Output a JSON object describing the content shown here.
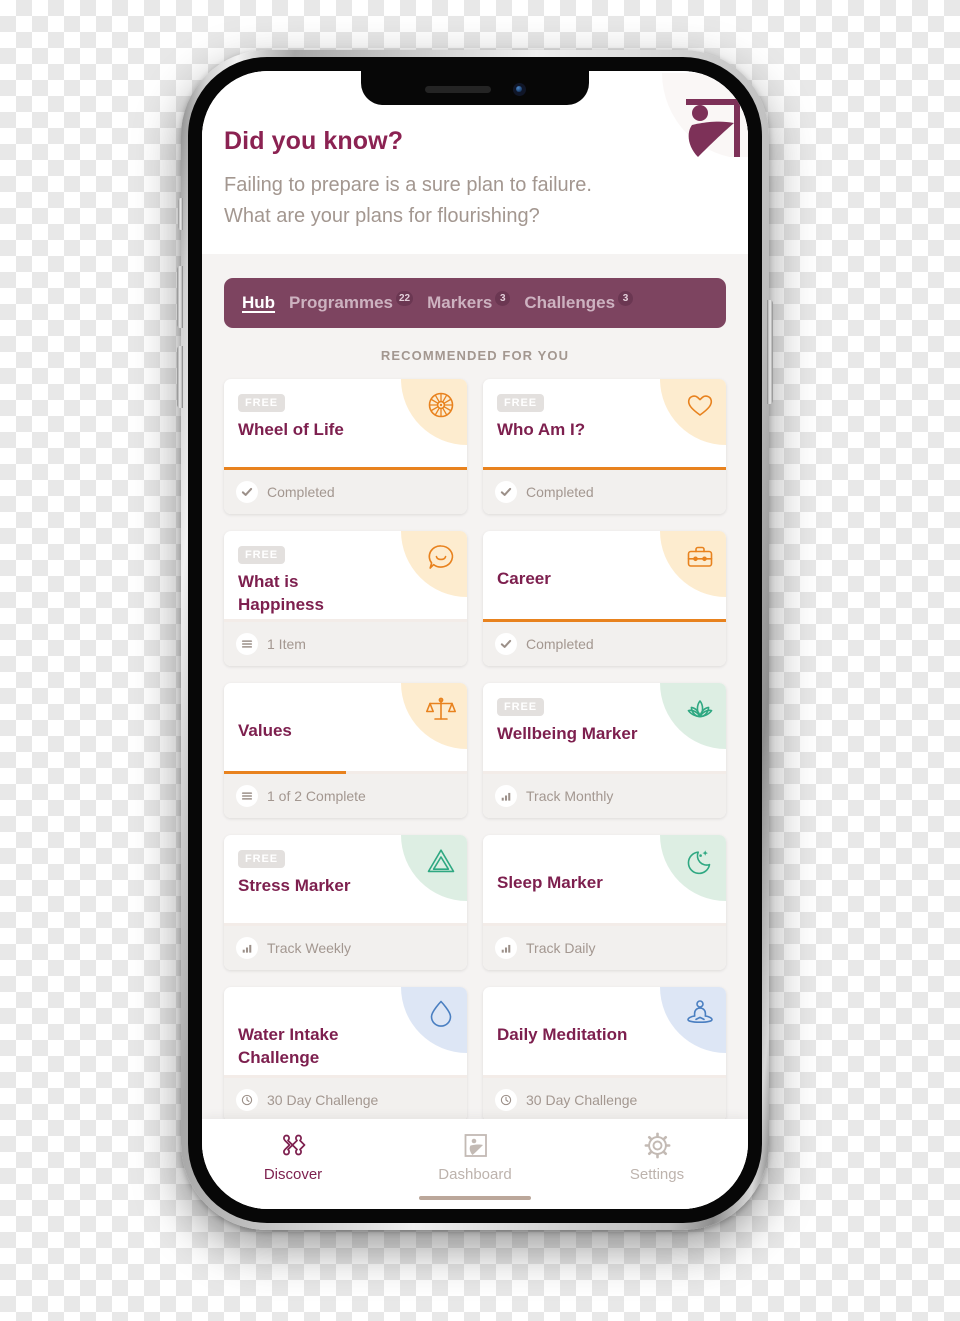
{
  "header": {
    "headline": "Did you know?",
    "subtext_line1": "Failing to prepare is a sure plan to failure.",
    "subtext_line2": "What are your plans for flourishing?",
    "logo_icon": "flourishing-figure-logo"
  },
  "tabs": [
    {
      "label": "Hub",
      "badge": "",
      "active": true
    },
    {
      "label": "Programmes",
      "badge": "22",
      "active": false
    },
    {
      "label": "Markers",
      "badge": "3",
      "active": false
    },
    {
      "label": "Challenges",
      "badge": "3",
      "active": false
    }
  ],
  "section": {
    "title": "RECOMMENDED FOR YOU"
  },
  "cards": [
    {
      "title": "Wheel of Life",
      "free": true,
      "badge_label": "FREE",
      "icon": "wheel-icon",
      "theme": "orange",
      "progress": 100,
      "foot_icon": "check-icon",
      "foot_text": "Completed"
    },
    {
      "title": "Who Am I?",
      "free": true,
      "badge_label": "FREE",
      "icon": "heart-icon",
      "theme": "orange",
      "progress": 100,
      "foot_icon": "check-icon",
      "foot_text": "Completed"
    },
    {
      "title": "What is Happiness",
      "free": true,
      "badge_label": "FREE",
      "icon": "speech-icon",
      "theme": "orange",
      "progress": 0,
      "foot_icon": "list-icon",
      "foot_text": "1 Item"
    },
    {
      "title": "Career",
      "free": false,
      "badge_label": "",
      "icon": "briefcase-icon",
      "theme": "orange",
      "progress": 100,
      "foot_icon": "check-icon",
      "foot_text": "Completed"
    },
    {
      "title": "Values",
      "free": false,
      "badge_label": "",
      "icon": "scales-icon",
      "theme": "orange",
      "progress": 50,
      "foot_icon": "list-icon",
      "foot_text": "1 of 2 Complete"
    },
    {
      "title": "Wellbeing Marker",
      "free": true,
      "badge_label": "FREE",
      "icon": "lotus-icon",
      "theme": "green",
      "progress": 0,
      "foot_icon": "chart-icon",
      "foot_text": "Track Monthly"
    },
    {
      "title": "Stress Marker",
      "free": true,
      "badge_label": "FREE",
      "icon": "triangle-icon",
      "theme": "green",
      "progress": 0,
      "foot_icon": "chart-icon",
      "foot_text": "Track Weekly"
    },
    {
      "title": "Sleep Marker",
      "free": false,
      "badge_label": "",
      "icon": "moon-icon",
      "theme": "green",
      "progress": 0,
      "foot_icon": "chart-icon",
      "foot_text": "Track Daily"
    },
    {
      "title": "Water Intake Challenge",
      "free": false,
      "badge_label": "",
      "icon": "droplet-icon",
      "theme": "blue",
      "progress": 0,
      "foot_icon": "clock-icon",
      "foot_text": "30 Day Challenge"
    },
    {
      "title": "Daily Meditation",
      "free": false,
      "badge_label": "",
      "icon": "meditation-icon",
      "theme": "blue",
      "progress": 0,
      "foot_icon": "clock-icon",
      "foot_text": "30 Day Challenge"
    }
  ],
  "bottom_nav": [
    {
      "label": "Discover",
      "icon": "puzzle-icon",
      "active": true
    },
    {
      "label": "Dashboard",
      "icon": "figure-icon",
      "active": false
    },
    {
      "label": "Settings",
      "icon": "gear-icon",
      "active": false
    }
  ],
  "colors": {
    "brand_maroon": "#7d1f4e",
    "tabbar_plum": "#7d4460",
    "accent_orange": "#e8821e",
    "accent_green": "#2fa882",
    "accent_blue": "#4a7fc1",
    "page_bg": "#f5f3f2",
    "muted_text": "#a39790"
  }
}
